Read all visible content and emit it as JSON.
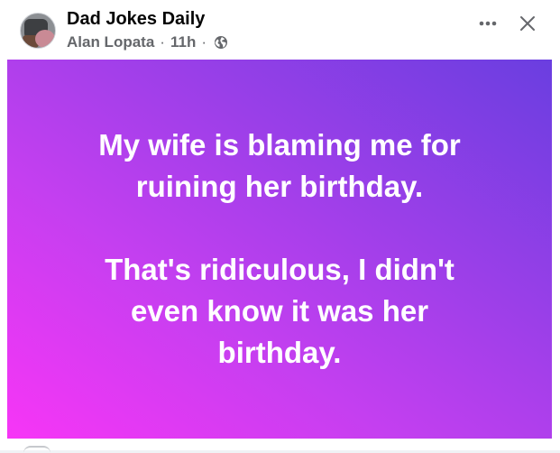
{
  "post": {
    "group_name": "Dad Jokes Daily",
    "author": "Alan Lopata",
    "separator": "·",
    "time": "11h",
    "privacy_icon": "globe-icon",
    "more_icon": "more-horizontal-icon",
    "close_icon": "close-icon",
    "text_lines_1": [
      "My wife is blaming me for",
      "ruining her birthday."
    ],
    "text_lines_2": [
      "That's ridiculous, I didn't",
      "even know it was her",
      "birthday."
    ],
    "background_gradient": [
      "#f735f6",
      "#9a3fe8",
      "#6a3ee0"
    ]
  }
}
